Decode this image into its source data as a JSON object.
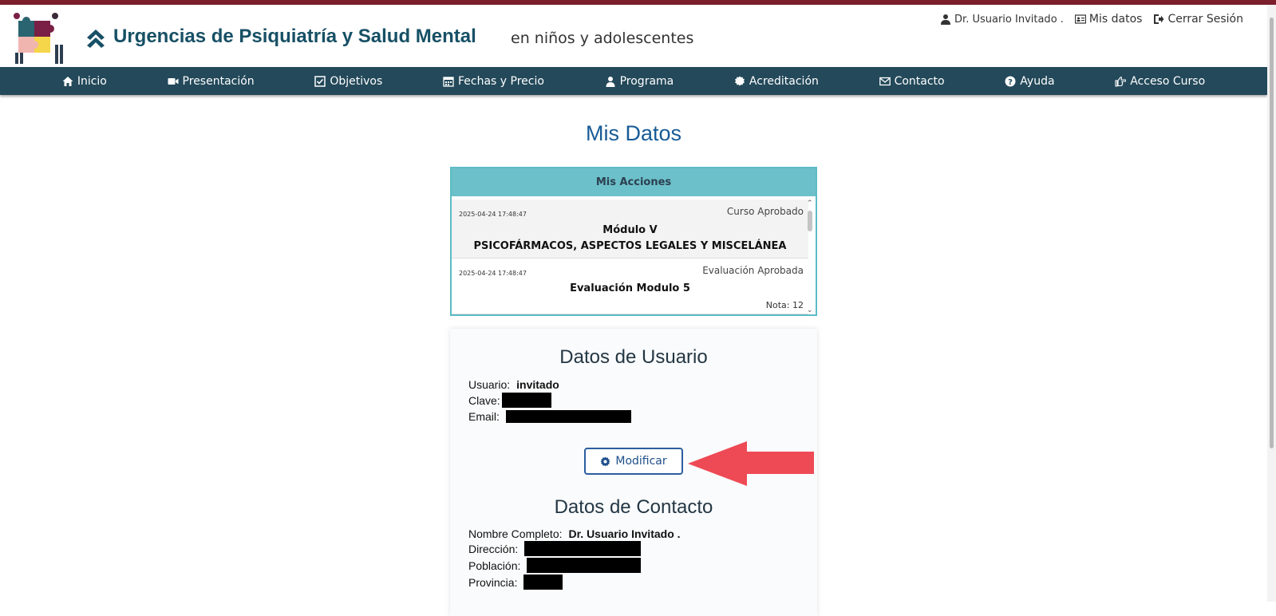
{
  "header": {
    "title": "Urgencias de Psiquiatría y Salud Mental",
    "subtitle": "en niños y adolescentes",
    "user_name": "Dr. Usuario Invitado .",
    "my_data_link": "Mis datos",
    "logout_link": "Cerrar Sesión"
  },
  "nav": {
    "items": [
      {
        "label": "Inicio",
        "icon": "home-icon"
      },
      {
        "label": "Presentación",
        "icon": "video-icon"
      },
      {
        "label": "Objetivos",
        "icon": "check-square-icon"
      },
      {
        "label": "Fechas y Precio",
        "icon": "calendar-icon"
      },
      {
        "label": "Programa",
        "icon": "user-icon"
      },
      {
        "label": "Acreditación",
        "icon": "certificate-icon"
      },
      {
        "label": "Contacto",
        "icon": "envelope-icon"
      },
      {
        "label": "Ayuda",
        "icon": "question-icon"
      },
      {
        "label": "Acceso Curso",
        "icon": "hand-point-right-icon"
      }
    ]
  },
  "page": {
    "title": "Mis Datos"
  },
  "actions": {
    "header": "Mis Acciones",
    "entries": [
      {
        "date": "2025-04-24 17:48:47",
        "status": "Curso Aprobado",
        "line1": "Módulo V",
        "line2": "PSICOFÁRMACOS, ASPECTOS LEGALES Y MISCELÁNEA"
      },
      {
        "date": "2025-04-24 17:48:47",
        "status": "Evaluación Aprobada",
        "line1": "Evaluación Modulo 5",
        "note": "Nota: 12"
      }
    ]
  },
  "user_data": {
    "heading": "Datos de Usuario",
    "username_label": "Usuario:",
    "username_value": "invitado",
    "password_label": "Clave:",
    "email_label": "Email:",
    "modify_button": "Modificar"
  },
  "contact_data": {
    "heading": "Datos de Contacto",
    "fullname_label": "Nombre Completo:",
    "fullname_value": "Dr. Usuario Invitado .",
    "address_label": "Dirección:",
    "town_label": "Población:",
    "province_label": "Provincia:"
  },
  "colors": {
    "nav_bg": "#23495a",
    "top_line": "#7a1f2b",
    "title_blue": "#175b96",
    "table_header": "#6cc0c9",
    "arrow_red": "#ee4a55"
  }
}
